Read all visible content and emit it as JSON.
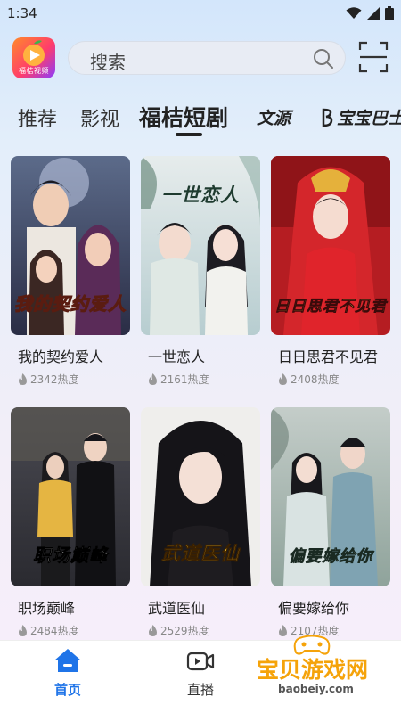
{
  "status_bar": {
    "time": "1:34"
  },
  "header": {
    "logo_text": "福桔视频",
    "search_placeholder": "搜索"
  },
  "tabs": [
    {
      "label": "推荐",
      "active": false
    },
    {
      "label": "影视",
      "active": false
    },
    {
      "label": "福桔短剧",
      "active": true
    },
    {
      "label": "文源",
      "active": false
    },
    {
      "label": "宝宝巴士",
      "active": false
    }
  ],
  "cards": [
    {
      "title": "我的契约爱人",
      "poster_text": "我的契约爱人",
      "heat": "2342热度"
    },
    {
      "title": "一世恋人",
      "poster_text": "一世恋人",
      "heat": "2161热度"
    },
    {
      "title": "日日思君不见君",
      "poster_text": "日日思君不见君",
      "heat": "2408热度"
    },
    {
      "title": "职场巅峰",
      "poster_text": "职场巅峰",
      "heat": "2484热度"
    },
    {
      "title": "武道医仙",
      "poster_text": "武道医仙",
      "heat": "2529热度"
    },
    {
      "title": "偏要嫁给你",
      "poster_text": "偏要嫁给你",
      "heat": "2107热度"
    }
  ],
  "bottom_nav": [
    {
      "label": "首页",
      "icon": "home-icon",
      "active": true
    },
    {
      "label": "直播",
      "icon": "live-video-icon",
      "active": false
    }
  ],
  "watermark": {
    "text": "宝贝游戏网",
    "url": "baobeiy.com"
  },
  "colors": {
    "accent": "#1f74e8",
    "watermark": "#f5a30a"
  }
}
